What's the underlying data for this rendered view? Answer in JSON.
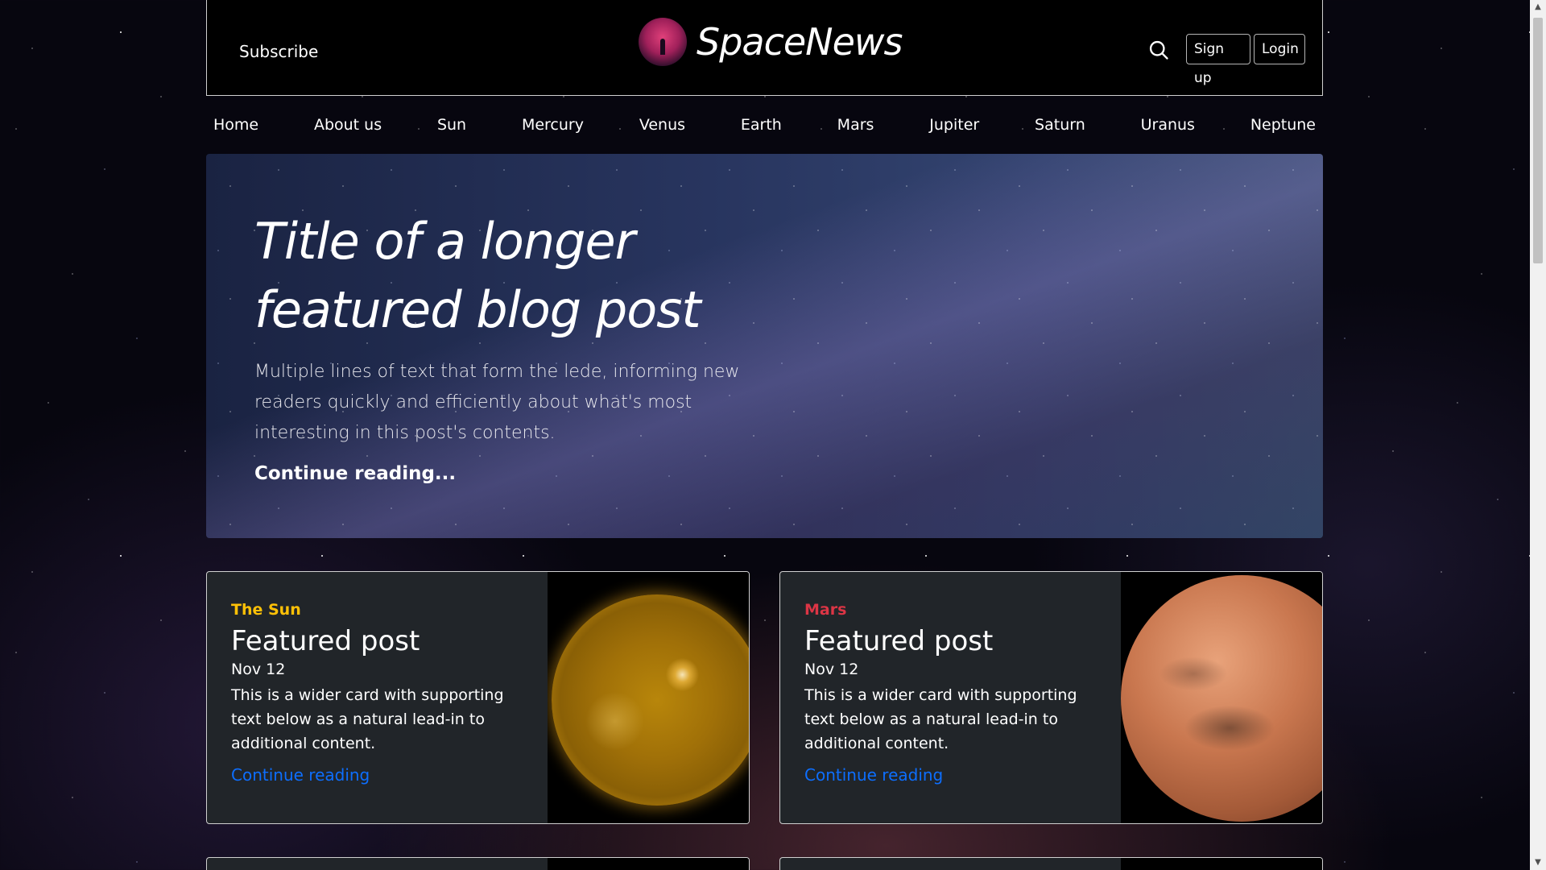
{
  "header": {
    "subscribe_label": "Subscribe",
    "brand_name": "SpaceNews",
    "signup_label": "Sign up",
    "login_label": "Login"
  },
  "nav": {
    "items": [
      "Home",
      "About us",
      "Sun",
      "Mercury",
      "Venus",
      "Earth",
      "Mars",
      "Jupiter",
      "Saturn",
      "Uranus",
      "Neptune"
    ]
  },
  "hero": {
    "title_line1": "Title of a longer",
    "title_line2": "featured blog post",
    "lede": "Multiple lines of text that form the lede, informing new readers quickly and efficiently about what's most interesting in this post's contents.",
    "link_label": "Continue reading..."
  },
  "cards": [
    {
      "category": "The Sun",
      "category_color": "#ffc107",
      "title": "Featured post",
      "date": "Nov 12",
      "text": "This is a wider card with supporting text below as a natural lead-in to additional content.",
      "link_label": "Continue reading",
      "image": "sun-image"
    },
    {
      "category": "Mars",
      "category_color": "#dc3545",
      "title": "Featured post",
      "date": "Nov 12",
      "text": "This is a wider card with supporting text below as a natural lead-in to additional content.",
      "link_label": "Continue reading",
      "image": "mars-image"
    }
  ],
  "colors": {
    "link": "#0d6efd",
    "card_bg": "#212529"
  }
}
